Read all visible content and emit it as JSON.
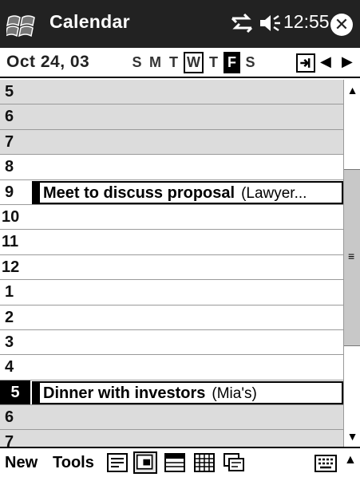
{
  "titlebar": {
    "app_title": "Calendar",
    "time": "12:55",
    "icons": [
      "start-windows-flag-icon",
      "connectivity-icon",
      "speaker-icon",
      "close-icon"
    ],
    "close_symbol": "✕"
  },
  "datebar": {
    "date": "Oct 24, 03",
    "weekdays": [
      "S",
      "M",
      "T",
      "W",
      "T",
      "F",
      "S"
    ],
    "today_index": 3,
    "selected_index": 5,
    "prev_symbol": "◀",
    "next_symbol": "▶"
  },
  "day_view": {
    "hours": [
      {
        "label": "5",
        "shade": "grey"
      },
      {
        "label": "6",
        "shade": "grey"
      },
      {
        "label": "7",
        "shade": "grey"
      },
      {
        "label": "8",
        "shade": "white"
      },
      {
        "label": "9",
        "shade": "white"
      },
      {
        "label": "10",
        "shade": "white"
      },
      {
        "label": "11",
        "shade": "white"
      },
      {
        "label": "12",
        "shade": "white"
      },
      {
        "label": "1",
        "shade": "white"
      },
      {
        "label": "2",
        "shade": "white"
      },
      {
        "label": "3",
        "shade": "white"
      },
      {
        "label": "4",
        "shade": "white"
      },
      {
        "label": "5",
        "shade": "white",
        "current": true
      },
      {
        "label": "6",
        "shade": "grey"
      },
      {
        "label": "7",
        "shade": "grey"
      }
    ],
    "appointments": [
      {
        "hour_index": 4,
        "title": "Meet to discuss proposal",
        "location": "(Lawyer..."
      },
      {
        "hour_index": 12,
        "title": "Dinner with investors",
        "location": "(Mia's)"
      }
    ]
  },
  "scrollbar": {
    "up_symbol": "▲",
    "down_symbol": "▼",
    "grip_symbol": "≡"
  },
  "commandbar": {
    "new_label": "New",
    "tools_label": "Tools",
    "views": [
      "agenda-view-icon",
      "day-view-icon",
      "week-view-icon",
      "month-view-icon",
      "year-view-icon"
    ],
    "active_view_index": 1,
    "sip_symbol": "▲"
  }
}
